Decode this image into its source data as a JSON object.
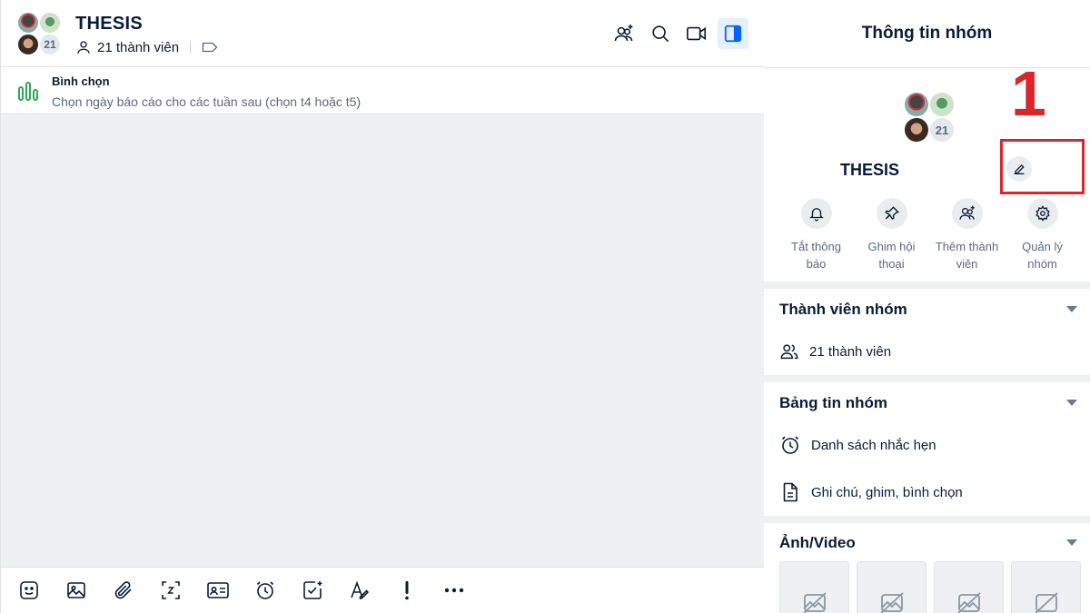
{
  "chat": {
    "title": "THESIS",
    "member_count_label": "21 thành viên",
    "avatar_count": "21"
  },
  "pin": {
    "title": "Bình chọn",
    "text": "Chọn ngày báo cáo cho các tuần sau (chọn t4 hoặc t5)"
  },
  "panel": {
    "title": "Thông tin nhóm",
    "group_name": "THESIS",
    "avatar_count": "21",
    "annotation_number": "1",
    "actions": [
      {
        "label": "Tắt thông báo",
        "icon": "bell-icon"
      },
      {
        "label": "Ghim hội thoại",
        "icon": "pin-icon"
      },
      {
        "label": "Thêm thành viên",
        "icon": "add-user-icon"
      },
      {
        "label": "Quản lý nhóm",
        "icon": "gear-icon"
      }
    ],
    "members_section": {
      "title": "Thành viên nhóm",
      "count_label": "21 thành viên"
    },
    "board_section": {
      "title": "Bảng tin nhóm",
      "reminders": "Danh sách nhắc hẹn",
      "notes": "Ghi chú, ghim, bình chọn"
    },
    "media_section": {
      "title": "Ảnh/Video"
    }
  },
  "colors": {
    "accent": "#0068ff",
    "annotation": "#d9262c",
    "poll": "#2aa85a"
  }
}
